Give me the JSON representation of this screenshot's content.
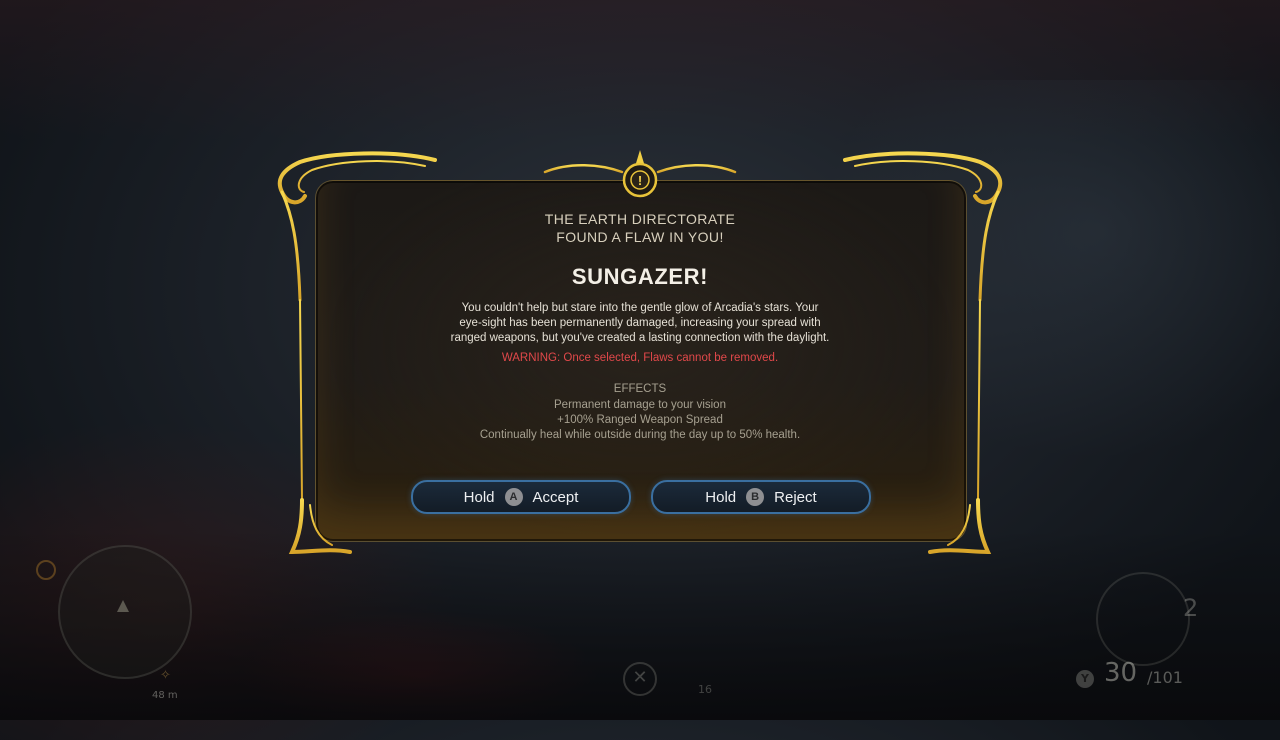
{
  "dialog": {
    "header_line1": "THE EARTH DIRECTORATE",
    "header_line2": "FOUND A FLAW IN YOU!",
    "title": "SUNGAZER!",
    "description": [
      "You couldn't help but stare into the gentle glow of Arcadia's stars. Your",
      "eye-sight has been permanently damaged, increasing your spread with",
      "ranged weapons, but you've created a lasting connection with the daylight."
    ],
    "warning": "WARNING: Once selected, Flaws cannot be removed.",
    "effects_title": "EFFECTS",
    "effects": [
      "Permanent damage to your vision",
      "+100% Ranged Weapon Spread",
      "Continually heal while outside during the day up to 50% health."
    ],
    "top_emblem": "!",
    "accept": {
      "hold": "Hold",
      "glyph": "A",
      "label": "Accept"
    },
    "reject": {
      "hold": "Hold",
      "glyph": "B",
      "label": "Reject"
    }
  },
  "hud": {
    "distance": "48 m",
    "item_count": "16",
    "grenades": "2",
    "ammo_button": "Y",
    "ammo_clip": "30",
    "ammo_reserve": "/101"
  },
  "colors": {
    "gold": "#e8c33a",
    "warning": "#e0484a",
    "button_border": "#3a6fa0"
  }
}
